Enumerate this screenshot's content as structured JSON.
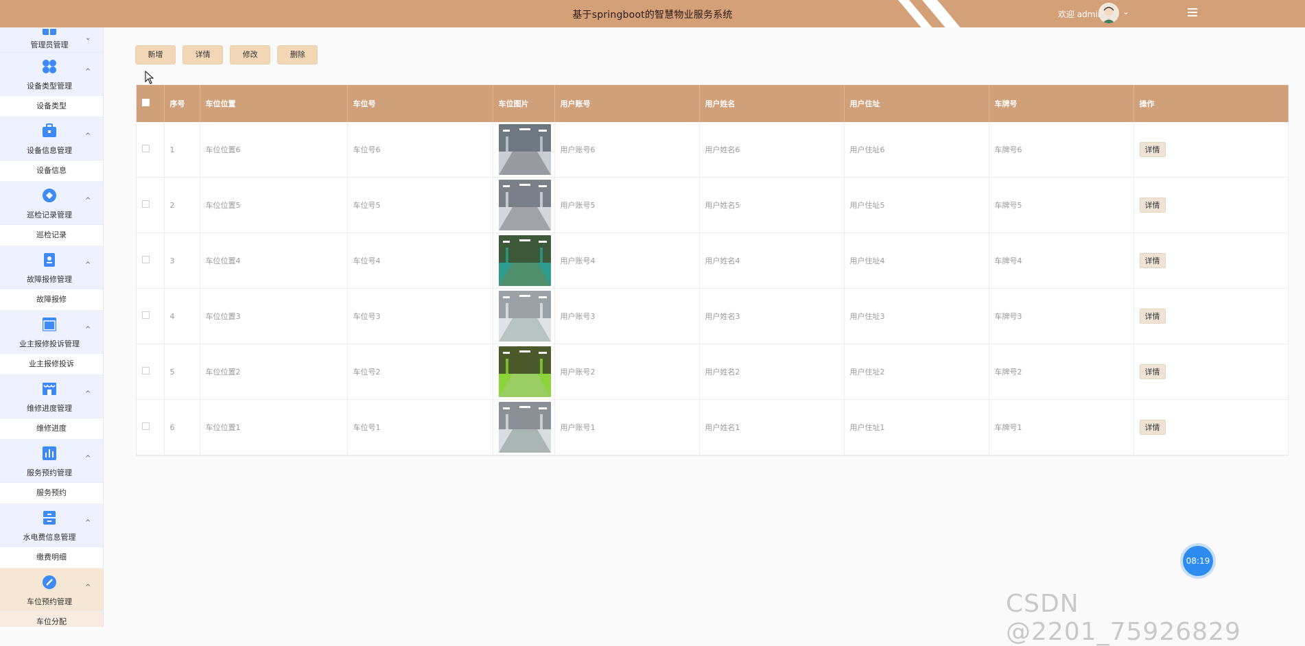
{
  "header": {
    "title": "基于springboot的智慧物业服务系统",
    "welcome": "欢迎 admin",
    "caret": "⌄",
    "colors": {
      "bar": "#d3a078"
    }
  },
  "sidebar": {
    "groups": [
      {
        "label": "管理员管理",
        "icon": "grid-icon",
        "color": "#3d8af7",
        "sub": ""
      },
      {
        "label": "设备类型管理",
        "icon": "apps-icon",
        "color": "#3d8af7",
        "sub": "设备类型"
      },
      {
        "label": "设备信息管理",
        "icon": "briefcase-icon",
        "color": "#3d8af7",
        "sub": "设备信息"
      },
      {
        "label": "巡检记录管理",
        "icon": "compass-icon",
        "color": "#3d8af7",
        "sub": "巡检记录"
      },
      {
        "label": "故障报修管理",
        "icon": "contact-card-icon",
        "color": "#3d8af7",
        "sub": "故障报修"
      },
      {
        "label": "业主报修投诉管理",
        "icon": "window-icon",
        "color": "#3d8af7",
        "sub": "业主报修投诉"
      },
      {
        "label": "维修进度管理",
        "icon": "store-icon",
        "color": "#3d8af7",
        "sub": "维修进度"
      },
      {
        "label": "服务预约管理",
        "icon": "bar-chart-icon",
        "color": "#3d8af7",
        "sub": "服务预约"
      },
      {
        "label": "水电费信息管理",
        "icon": "cabinet-icon",
        "color": "#3d8af7",
        "sub": "缴费明细"
      },
      {
        "label": "车位预约管理",
        "icon": "gauge-icon",
        "color": "#3d8af7",
        "sub": "车位分配"
      }
    ]
  },
  "toolbar": {
    "add": "新增",
    "detail": "详情",
    "edit": "修改",
    "delete": "删除"
  },
  "table": {
    "columns": [
      "序号",
      "车位位置",
      "车位号",
      "车位图片",
      "用户账号",
      "用户姓名",
      "用户住址",
      "车牌号",
      "操作"
    ],
    "action_label": "详情",
    "rows": [
      {
        "no": "1",
        "location": "车位位置6",
        "spot": "车位号6",
        "image": "parking-garage-photo",
        "account": "用户账号6",
        "name": "用户姓名6",
        "address": "用户住址6",
        "plate": "车牌号6"
      },
      {
        "no": "2",
        "location": "车位位置5",
        "spot": "车位号5",
        "image": "parking-garage-photo",
        "account": "用户账号5",
        "name": "用户姓名5",
        "address": "用户住址5",
        "plate": "车牌号5"
      },
      {
        "no": "3",
        "location": "车位位置4",
        "spot": "车位号4",
        "image": "parking-garage-photo",
        "account": "用户账号4",
        "name": "用户姓名4",
        "address": "用户住址4",
        "plate": "车牌号4"
      },
      {
        "no": "4",
        "location": "车位位置3",
        "spot": "车位号3",
        "image": "parking-garage-photo",
        "account": "用户账号3",
        "name": "用户姓名3",
        "address": "用户住址3",
        "plate": "车牌号3"
      },
      {
        "no": "5",
        "location": "车位位置2",
        "spot": "车位号2",
        "image": "parking-garage-photo",
        "account": "用户账号2",
        "name": "用户姓名2",
        "address": "用户住址2",
        "plate": "车牌号2"
      },
      {
        "no": "6",
        "location": "车位位置1",
        "spot": "车位号1",
        "image": "parking-garage-photo",
        "account": "用户账号1",
        "name": "用户姓名1",
        "address": "用户住址1",
        "plate": "车牌号1"
      }
    ]
  },
  "clock": {
    "time": "08:19"
  },
  "watermark": "CSDN @2201_75926829"
}
